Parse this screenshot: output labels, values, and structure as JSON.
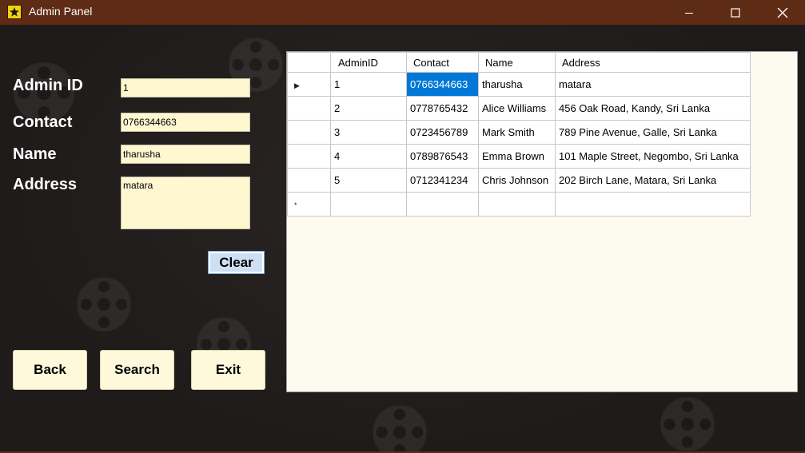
{
  "window": {
    "title": "Admin Panel",
    "icon": "film-star-icon"
  },
  "form": {
    "admin_id": {
      "label": "Admin ID",
      "value": "1"
    },
    "contact": {
      "label": "Contact",
      "value": "0766344663"
    },
    "name": {
      "label": "Name",
      "value": "tharusha"
    },
    "address": {
      "label": "Address",
      "value": "matara"
    }
  },
  "buttons": {
    "clear": "Clear",
    "back": "Back",
    "search": "Search",
    "exit": "Exit"
  },
  "grid": {
    "columns": [
      "AdminID",
      "Contact",
      "Name",
      "Address"
    ],
    "rows": [
      [
        "1",
        "0766344663",
        "tharusha",
        "matara"
      ],
      [
        "2",
        "0778765432",
        "Alice Williams",
        "456 Oak Road, Kandy, Sri Lanka"
      ],
      [
        "3",
        "0723456789",
        "Mark Smith",
        "789 Pine Avenue, Galle, Sri Lanka"
      ],
      [
        "4",
        "0789876543",
        "Emma Brown",
        "101 Maple Street, Negombo, Sri Lanka"
      ],
      [
        "5",
        "0712341234",
        "Chris Johnson",
        "202 Birch Lane, Matara, Sri Lanka"
      ]
    ],
    "current_row_marker": "▶",
    "new_row_marker": "*"
  },
  "colors": {
    "titlebar": "#5e2c14",
    "background": "#201d1c",
    "field_bg": "#fef7d0",
    "selection": "#0078d7"
  }
}
